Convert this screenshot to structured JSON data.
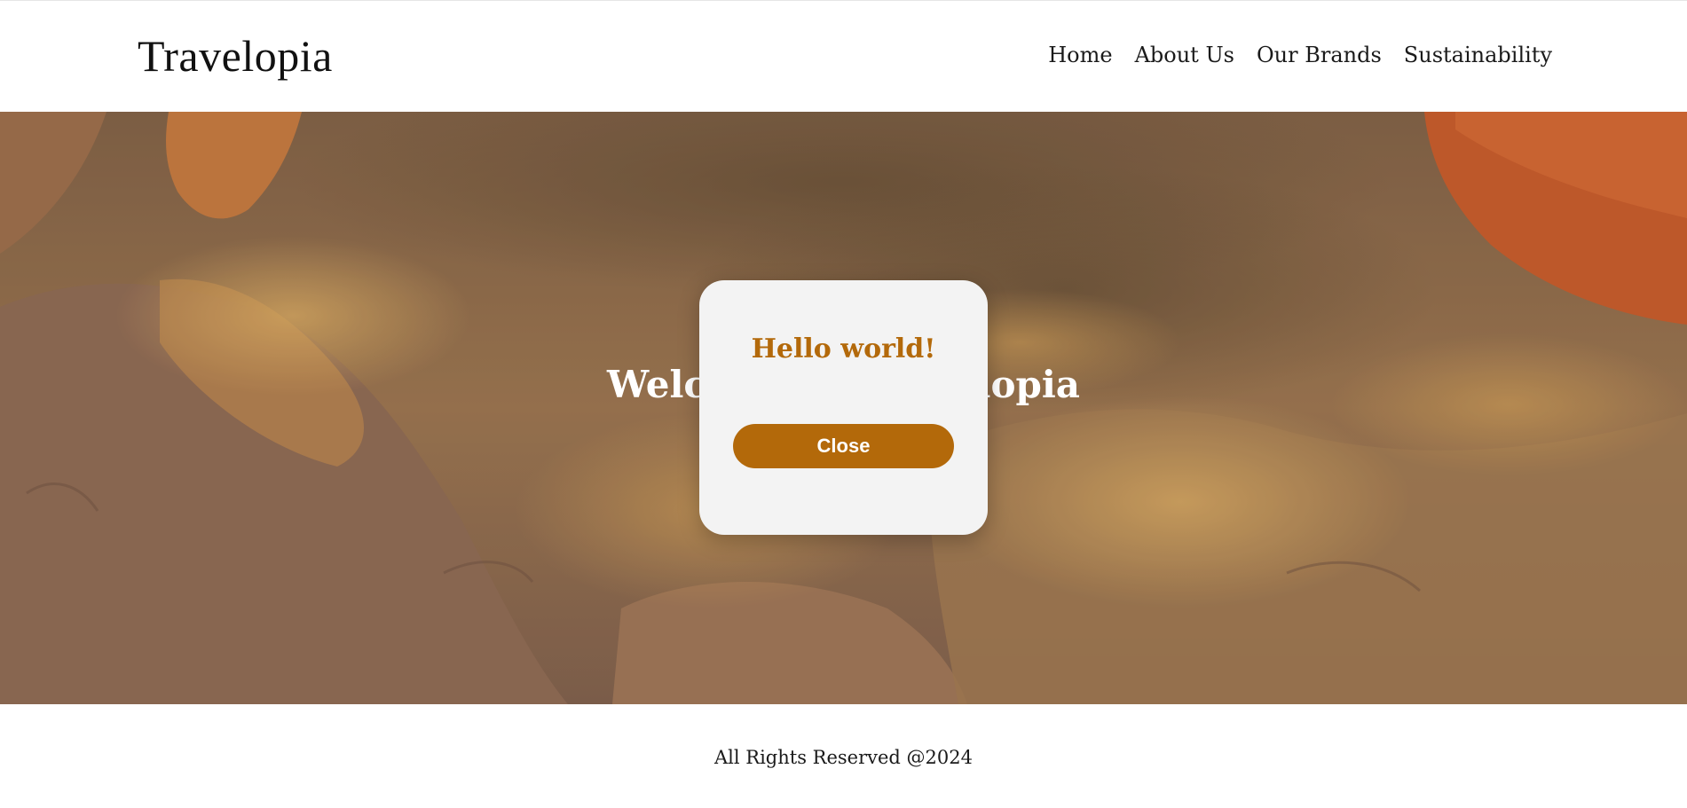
{
  "header": {
    "logo": "Travelopia",
    "nav": [
      "Home",
      "About Us",
      "Our Brands",
      "Sustainability"
    ]
  },
  "hero": {
    "title": "Welcome to Travelopia"
  },
  "modal": {
    "title": "Hello world!",
    "button_label": "Close"
  },
  "footer": {
    "text": "All Rights Reserved @2024"
  },
  "colors": {
    "accent": "#b3690a",
    "modal_background": "#f3f3f3"
  }
}
